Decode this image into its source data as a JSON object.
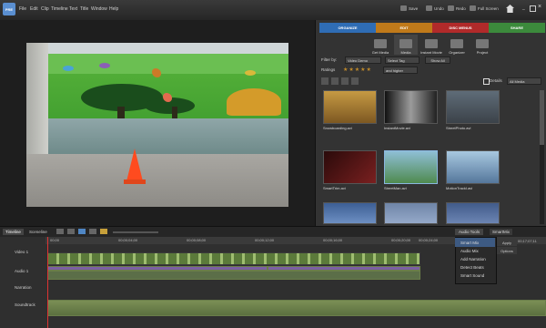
{
  "app": {
    "logo_text": "PRE"
  },
  "menu": [
    "File",
    "Edit",
    "Clip",
    "Timeline",
    "Text",
    "Title",
    "Window",
    "Help"
  ],
  "toolbar": {
    "save": "Save",
    "undo": "Undo",
    "redo": "Redo",
    "full_screen": "Full Screen"
  },
  "workspace_tabs": [
    {
      "label": "ORGANIZE",
      "color": "#2f6db5"
    },
    {
      "label": "EDIT",
      "color": "#c07a1a"
    },
    {
      "label": "DISC MENUS",
      "color": "#b12a2a"
    },
    {
      "label": "SHARE",
      "color": "#3c8a3c"
    }
  ],
  "organize_tabs": [
    "Get Media",
    "Media",
    "Instant Movie",
    "Organizer",
    "Project"
  ],
  "filters": {
    "filter_by_label": "Filter by:",
    "filter_by_value": "Video Demo",
    "tag_value": "Select Tag",
    "show_all": "Show All",
    "ratings_label": "Ratings",
    "rating_value": "and higher",
    "details_label": "Details",
    "details_value": "All Media"
  },
  "thumbnails": [
    {
      "caption": "Snowboarding.avi",
      "color": "#b3822d"
    },
    {
      "caption": "InstantMovie.avi",
      "color": "#6f6f6f"
    },
    {
      "caption": "StreetPhoto.avi",
      "color": "#556270"
    },
    {
      "caption": "SmartTrim.avi",
      "color": "#5a1818"
    },
    {
      "caption": "StreetMan.avi",
      "color": "#7b9b7b"
    },
    {
      "caption": "MotionTrackI.avi",
      "color": "#8aa6c2"
    },
    {
      "caption": "Portrait.avi",
      "color": "#3d5f95"
    },
    {
      "caption": "Scene2.avi",
      "color": "#6f85a7"
    },
    {
      "caption": "Scene3.avi",
      "color": "#415b8a"
    }
  ],
  "preview": {
    "timecode": "00;00;00;00"
  },
  "timeline": {
    "tabs": [
      "Timeline",
      "Sceneline"
    ],
    "timecodes": [
      "00;00",
      "00;00;04;00",
      "00;00;08;00",
      "00;00;12;00",
      "00;00;16;00",
      "00;00;20;00",
      "00;00;24;00"
    ],
    "tracks": [
      "Video 1",
      "Audio 1",
      "Narration",
      "Soundtrack"
    ],
    "audio_tools_label": "Audio Tools",
    "audio_tools_items": [
      "Smart Mix",
      "Audio Mix",
      "Add Narration",
      "Detect Beats",
      "Smart Sound"
    ],
    "smart_mix_label": "SmartMix",
    "apply_label": "Apply",
    "options_label": "Options",
    "right_timecode": "00;17;07;11"
  }
}
